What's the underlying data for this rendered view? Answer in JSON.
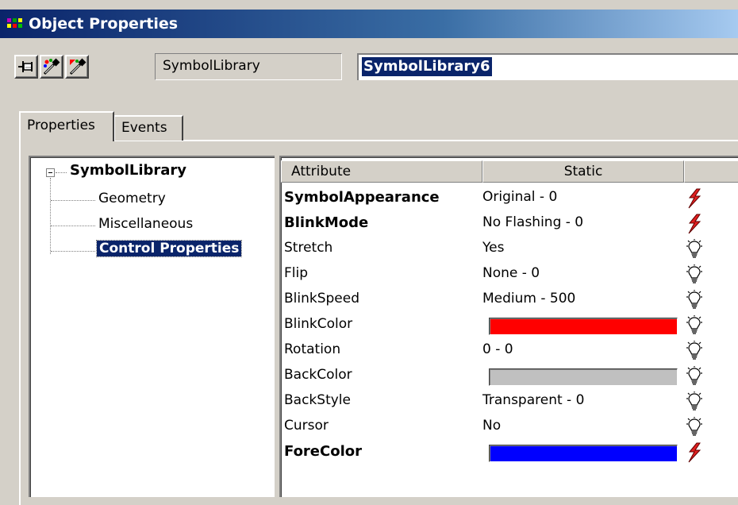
{
  "window": {
    "title": "Object Properties"
  },
  "toolbar": {
    "buttons": [
      {
        "icon": "pin-icon"
      },
      {
        "icon": "eyedropper-icon"
      },
      {
        "icon": "eyedropper-arrow-icon"
      }
    ],
    "object_type": "SymbolLibrary",
    "object_name": "SymbolLibrary6"
  },
  "tabs": [
    {
      "label": "Properties",
      "active": true
    },
    {
      "label": "Events",
      "active": false
    }
  ],
  "tree": {
    "root": "SymbolLibrary",
    "items": [
      {
        "label": "Geometry",
        "selected": false
      },
      {
        "label": "Miscellaneous",
        "selected": false
      },
      {
        "label": "Control Properties",
        "selected": true
      }
    ]
  },
  "grid": {
    "columns": [
      "Attribute",
      "Static",
      ""
    ],
    "rows": [
      {
        "attribute": "SymbolAppearance",
        "value": "Original - 0",
        "bold": true,
        "dynamic": "lightning-icon"
      },
      {
        "attribute": "BlinkMode",
        "value": "No Flashing - 0",
        "bold": true,
        "dynamic": "lightning-icon"
      },
      {
        "attribute": "Stretch",
        "value": "Yes",
        "bold": false,
        "dynamic": "lightbulb-icon"
      },
      {
        "attribute": "Flip",
        "value": "None - 0",
        "bold": false,
        "dynamic": "lightbulb-icon"
      },
      {
        "attribute": "BlinkSpeed",
        "value": "Medium - 500",
        "bold": false,
        "dynamic": "lightbulb-icon"
      },
      {
        "attribute": "BlinkColor",
        "value": "",
        "color": "#ff0000",
        "bold": false,
        "dynamic": "lightbulb-icon"
      },
      {
        "attribute": "Rotation",
        "value": "0 - 0",
        "bold": false,
        "dynamic": "lightbulb-icon"
      },
      {
        "attribute": "BackColor",
        "value": "",
        "color": "#c0c0c0",
        "bold": false,
        "dynamic": "lightbulb-icon"
      },
      {
        "attribute": "BackStyle",
        "value": "Transparent - 0",
        "bold": false,
        "dynamic": "lightbulb-icon"
      },
      {
        "attribute": "Cursor",
        "value": "No",
        "bold": false,
        "dynamic": "lightbulb-icon"
      },
      {
        "attribute": "ForeColor",
        "value": "",
        "color": "#0000ff",
        "bold": true,
        "dynamic": "lightning-icon"
      }
    ]
  },
  "colors": {
    "titlebar_start": "#0a246a",
    "titlebar_end": "#a6caf0",
    "selection": "#0a246a",
    "dialog_face": "#d4d0c8",
    "lightning": "#e02020"
  }
}
